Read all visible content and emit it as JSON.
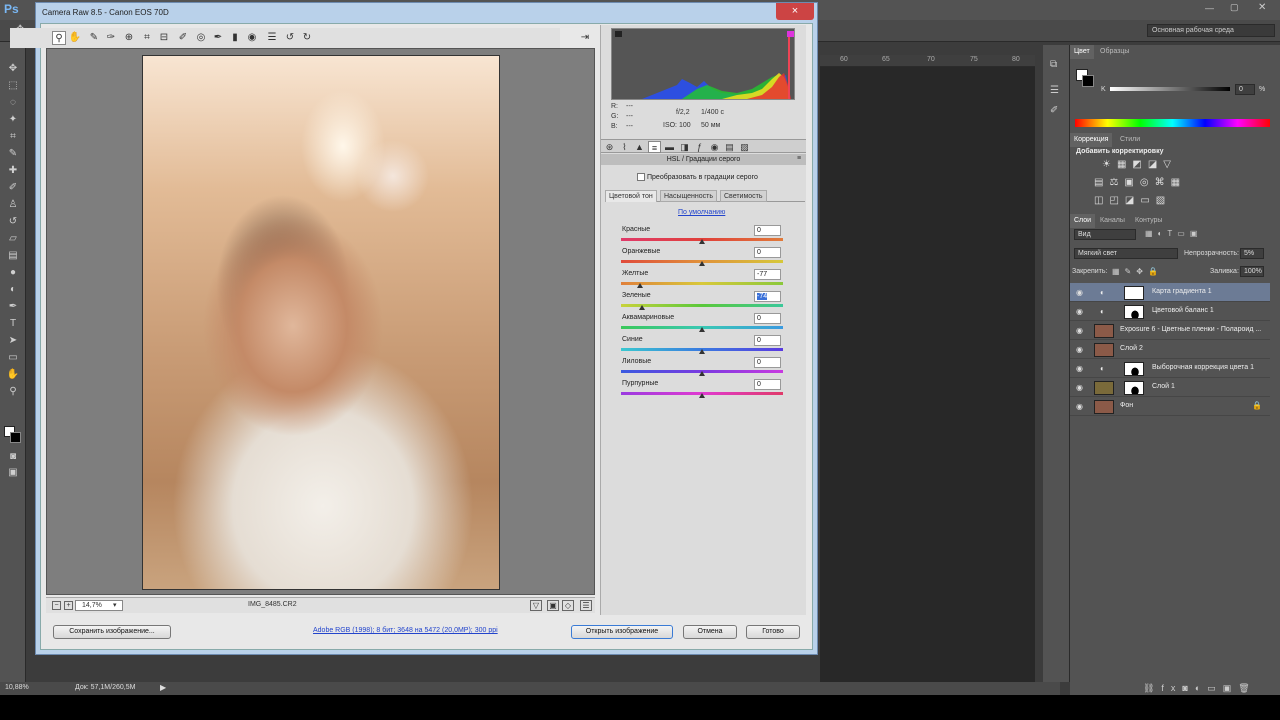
{
  "ps": {
    "logo": "Ps",
    "workspace": "Основная рабочая среда",
    "ruler_ticks": [
      "60",
      "65",
      "70",
      "75",
      "80"
    ],
    "status_zoom": "10,88%",
    "status_doc": "Док: 57,1M/260,5M"
  },
  "dialog": {
    "title": "Camera Raw 8.5  -  Canon EOS 70D",
    "close": "×",
    "filename": "IMG_8485.CR2",
    "zoom": "14,7%",
    "rgb": {
      "r": "R:",
      "g": "G:",
      "b": "B:",
      "r_val": "---",
      "g_val": "---",
      "b_val": "---"
    },
    "exif": {
      "aperture": "f/2,2",
      "shutter": "1/400 с",
      "iso": "ISO: 100",
      "focal": "50 мм"
    },
    "panel_title": "HSL / Градации серого",
    "grayscale_label": "Преобразовать в градации серого",
    "subtabs": [
      "Цветовой тон",
      "Насыщенность",
      "Светимость"
    ],
    "defaults_link": "По умолчанию",
    "sliders": [
      {
        "label": "Красные",
        "value": "0",
        "pos": 0.5
      },
      {
        "label": "Оранжевые",
        "value": "0",
        "pos": 0.5
      },
      {
        "label": "Желтые",
        "value": "-77",
        "pos": 0.115
      },
      {
        "label": "Зеленые",
        "value": "-74",
        "pos": 0.13
      },
      {
        "label": "Аквамариновые",
        "value": "0",
        "pos": 0.5
      },
      {
        "label": "Синие",
        "value": "0",
        "pos": 0.5
      },
      {
        "label": "Лиловые",
        "value": "0",
        "pos": 0.5
      },
      {
        "label": "Пурпурные",
        "value": "0",
        "pos": 0.5
      }
    ],
    "status_link": "Adobe RGB (1998); 8 бит; 3648 на 5472 (20,0MP); 300 ppi",
    "buttons": {
      "save": "Сохранить изображение...",
      "open": "Открыть изображение",
      "cancel": "Отмена",
      "done": "Готово"
    }
  },
  "panels": {
    "color_tabs": [
      "Цвет",
      "Образцы"
    ],
    "k_label": "K",
    "k_value": "0",
    "k_unit": "%",
    "adj_tabs": [
      "Коррекция",
      "Стили"
    ],
    "add_adjustment": "Добавить корректировку",
    "layer_tabs": [
      "Слои",
      "Каналы",
      "Контуры"
    ],
    "kind": "Вид",
    "blend_mode": "Мягкий свет",
    "opacity_label": "Непрозрачность:",
    "opacity": "5%",
    "lock_label": "Закрепить:",
    "fill_label": "Заливка:",
    "fill": "100%",
    "layers": [
      {
        "name": "Карта градиента 1",
        "selected": true
      },
      {
        "name": "Цветовой баланс 1",
        "selected": false
      },
      {
        "name": "Exposure 6 - Цветные пленки - Полароид ...",
        "selected": false
      },
      {
        "name": "Слой 2",
        "selected": false
      },
      {
        "name": "Выборочная коррекция цвета 1",
        "selected": false
      },
      {
        "name": "Слой 1",
        "selected": false
      },
      {
        "name": "Фон",
        "selected": false
      }
    ]
  },
  "colors": {
    "selection_blue": "#3a70d8",
    "link_blue": "#2244cc",
    "close_red": "#cc4444"
  }
}
